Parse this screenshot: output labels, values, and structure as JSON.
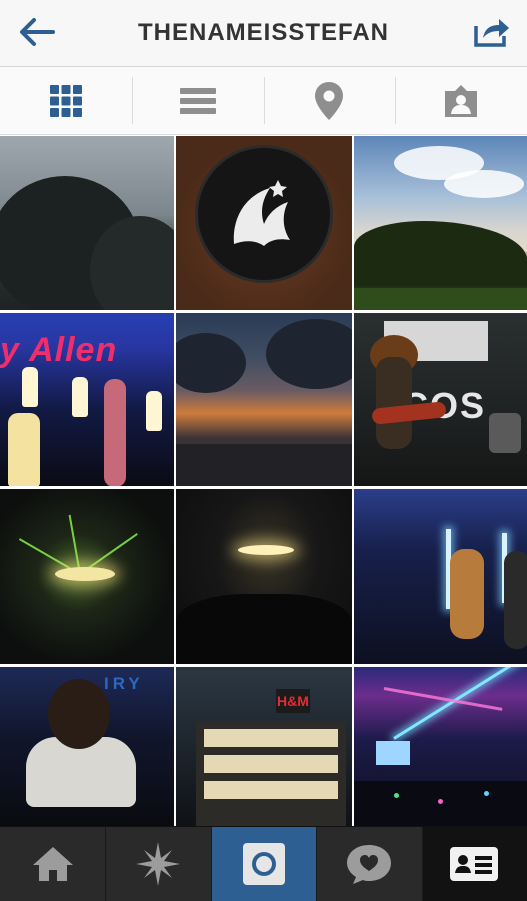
{
  "header": {
    "username": "THENAMEISSTEFAN",
    "back_icon": "arrow-left-icon",
    "share_icon": "share-icon"
  },
  "colors": {
    "accent": "#2d5f93",
    "header_bg": "#f7f7f7",
    "bottom_bar_bg": "#2a2a2a"
  },
  "tabs": [
    {
      "icon": "grid-icon",
      "selected": true
    },
    {
      "icon": "list-icon",
      "selected": false
    },
    {
      "icon": "map-pin-icon",
      "selected": false
    },
    {
      "icon": "tagged-photos-icon",
      "selected": false
    }
  ],
  "photos": [
    {
      "id": "rainy-trees"
    },
    {
      "id": "pegasus-logo"
    },
    {
      "id": "sky-sunset-field"
    },
    {
      "id": "singer-stage",
      "banner_text": "y Allen"
    },
    {
      "id": "sunset-clouds-road"
    },
    {
      "id": "band-guitarist",
      "stage_text": "ACOS"
    },
    {
      "id": "concert-green-lasers"
    },
    {
      "id": "concert-crowd-lights"
    },
    {
      "id": "performers-blue-lights"
    },
    {
      "id": "person-dark-portrait",
      "sign_text": "IRY"
    },
    {
      "id": "hm-store-night",
      "store_text": "H&M"
    },
    {
      "id": "concert-blue-beams"
    }
  ],
  "bottom_nav": [
    {
      "icon": "home-icon",
      "active": false
    },
    {
      "icon": "explore-star-icon",
      "active": false
    },
    {
      "icon": "camera-icon",
      "active": true
    },
    {
      "icon": "activity-heart-bubble-icon",
      "active": false
    },
    {
      "icon": "profile-card-icon",
      "active": true
    }
  ]
}
